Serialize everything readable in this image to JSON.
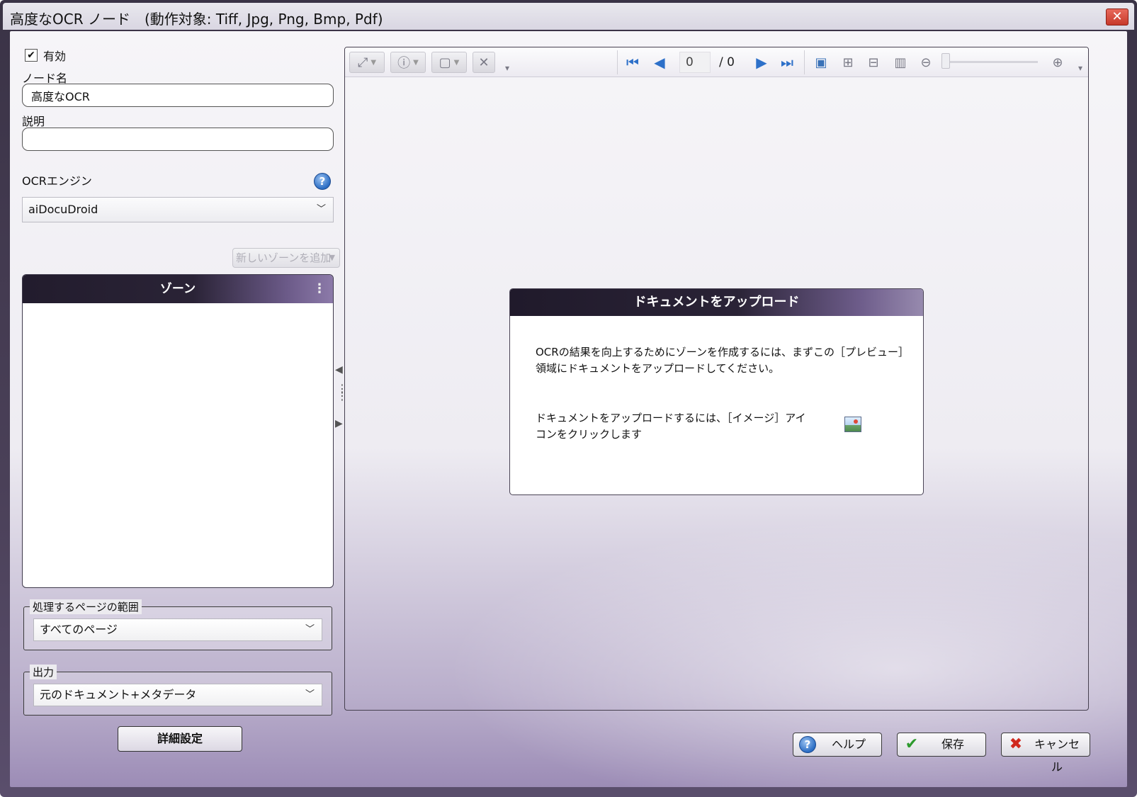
{
  "window": {
    "title": "高度なOCR ノード　(動作対象: Tiff, Jpg, Png, Bmp, Pdf)",
    "close_glyph": "✕"
  },
  "form": {
    "enabled_label": "有効",
    "enabled_checked": true,
    "node_name_label": "ノード名",
    "node_name_value": "高度なOCR",
    "description_label": "説明",
    "description_value": "",
    "ocr_engine_label": "OCRエンジン",
    "ocr_engine_value": "aiDocuDroid",
    "add_zone_label": "新しいゾーンを追加",
    "zones_title": "ゾーン",
    "zones_menu_glyph": "⋮",
    "page_range_label": "処理するページの範囲",
    "page_range_value": "すべてのページ",
    "output_label": "出力",
    "output_value": "元のドキュメント+メタデータ",
    "advanced_button": "詳細設定"
  },
  "preview": {
    "current_page": "0",
    "total_pages": "/  0",
    "upload_title": "ドキュメントをアップロード",
    "upload_text_1": "OCRの結果を向上するためにゾーンを作成するには、まずこの［プレビュー］領域にドキュメントをアップロードしてください。",
    "upload_text_2": "ドキュメントをアップロードするには、［イメージ］アイコンをクリックします",
    "icons": {
      "fit": "⤢",
      "info": "ⓘ",
      "page": "▢",
      "delete": "✕",
      "first": "⏮",
      "prev": "◀",
      "next": "▶",
      "last": "⏭",
      "image": "▣",
      "select": "⊞",
      "split": "⊟",
      "single": "▥",
      "zoom_out": "⊖",
      "zoom_in": "⊕",
      "overflow": "▾"
    }
  },
  "buttons": {
    "help": "ヘルプ",
    "save": "保存",
    "cancel": "キャンセル",
    "help_glyph": "?",
    "save_glyph": "✔",
    "cancel_glyph": "✖"
  },
  "colors": {
    "accent_dark": "#221c2d",
    "accent_purple": "#8c7aa9",
    "help_blue": "#2b6dc4",
    "save_green": "#2d9a2d",
    "cancel_red": "#d0281d"
  }
}
